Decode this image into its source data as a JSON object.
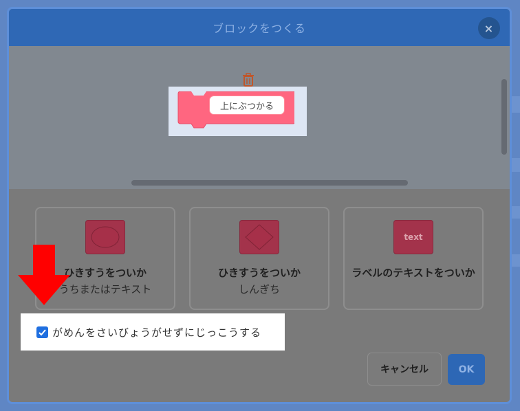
{
  "dialog": {
    "title": "ブロックをつくる",
    "close_label": "×"
  },
  "workspace": {
    "block_label": "上にぶつかる",
    "block_color": "#ff6680"
  },
  "options": [
    {
      "title": "ひきすうをついか",
      "subtitle": "うちまたはテキスト",
      "shape": "oval"
    },
    {
      "title": "ひきすうをついか",
      "subtitle": "しんぎち",
      "shape": "hexagon"
    },
    {
      "title": "ラベルのテキストをついか",
      "subtitle": "",
      "shape": "text",
      "shape_label": "text"
    }
  ],
  "checkbox": {
    "label": "がめんをさいびょうがせずにじっこうする",
    "checked": true
  },
  "buttons": {
    "cancel": "キャンセル",
    "ok": "OK"
  },
  "icons": {
    "trash": "trash-icon",
    "close": "close-icon",
    "arrow": "arrow-down-icon"
  },
  "colors": {
    "header": "#2f68b5",
    "accent": "#1f6fe0",
    "annotation_arrow": "#ff0000"
  }
}
